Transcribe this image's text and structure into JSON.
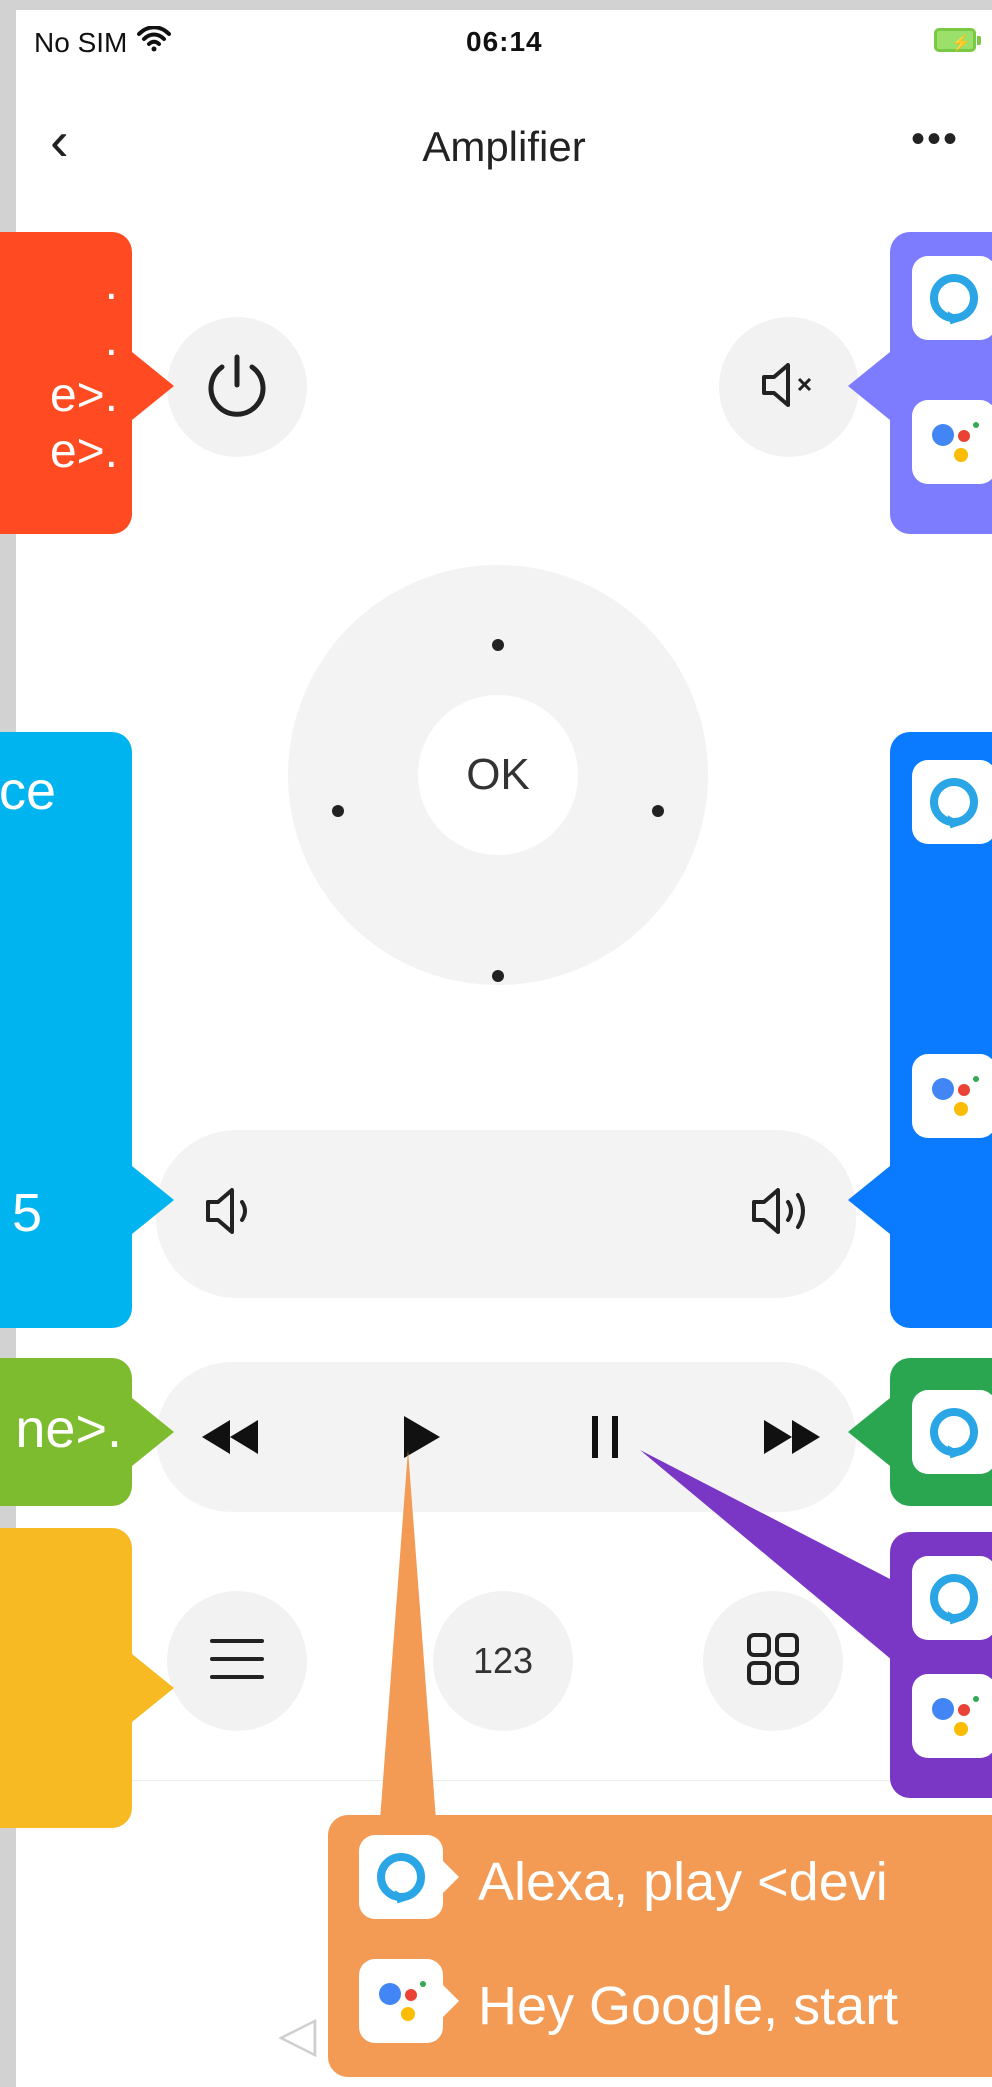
{
  "status_bar": {
    "carrier": "No SIM",
    "time": "06:14"
  },
  "header": {
    "back_icon": "chevron-left-icon",
    "title": "Amplifier",
    "more_icon": "more-horizontal-icon"
  },
  "remote": {
    "ok_label": "OK",
    "channel_label": "123",
    "icons": {
      "power": "power-icon",
      "mute": "mute-icon",
      "volume_down": "volume-down-icon",
      "volume_up": "volume-up-icon",
      "rewind": "rewind-icon",
      "play": "play-icon",
      "pause": "pause-icon",
      "fast_forward": "fast-forward-icon",
      "menu": "menu-icon",
      "apps": "apps-grid-icon"
    }
  },
  "callouts": {
    "power": {
      "lines": [
        ".",
        ".",
        "e>.",
        "e>."
      ],
      "color": "#ff4a22"
    },
    "mute": {
      "color": "#7d7cff"
    },
    "dpad_left": {
      "lines": [
        "ce"
      ],
      "color": "#00b4ef"
    },
    "volume_left": {
      "lines": [
        "5"
      ],
      "color": "#00b4ef"
    },
    "volume_right": {
      "color": "#0a7bff"
    },
    "media_left": {
      "lines": [
        "ne>."
      ],
      "color": "#7dbb2f"
    },
    "media_right": {
      "color": "#2aa650"
    },
    "menu_left": {
      "color": "#f8ba23"
    },
    "pause_right": {
      "color": "#7a37c5"
    },
    "play_bottom": {
      "alexa_text": "Alexa, play <devi",
      "google_text": "Hey Google, start",
      "color": "#f39b55"
    }
  },
  "nav_bar": {
    "back_icon": "nav-back-icon",
    "home_icon": "nav-home-icon",
    "recent_icon": "nav-recent-icon"
  }
}
